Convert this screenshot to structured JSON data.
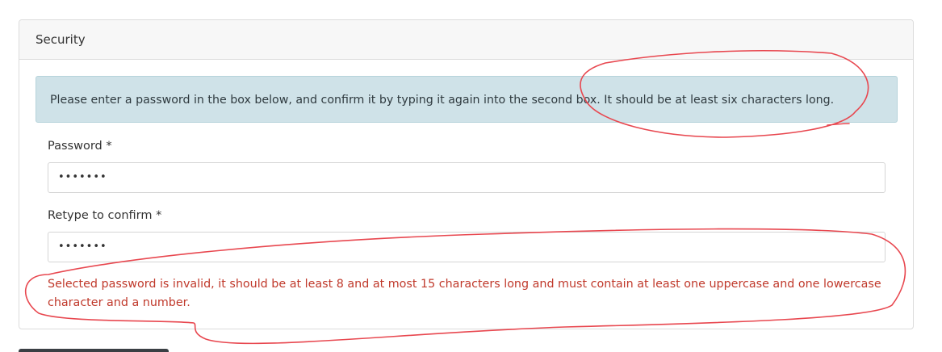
{
  "security": {
    "title": "Security",
    "info": "Please enter a password in the box below, and confirm it by typing it again into the second box. It should be at least six characters long.",
    "password_label": "Password *",
    "password_value": "•••••••",
    "confirm_label": "Retype to confirm *",
    "confirm_value": "•••••••",
    "error": "Selected password is invalid, it should be at least 8 and at most 15 characters long and must contain at least one uppercase and one lowercase character and a number."
  },
  "colors": {
    "annotation": "#e8474f",
    "info_background": "#cfe2e8",
    "error_text": "#c0392b"
  }
}
